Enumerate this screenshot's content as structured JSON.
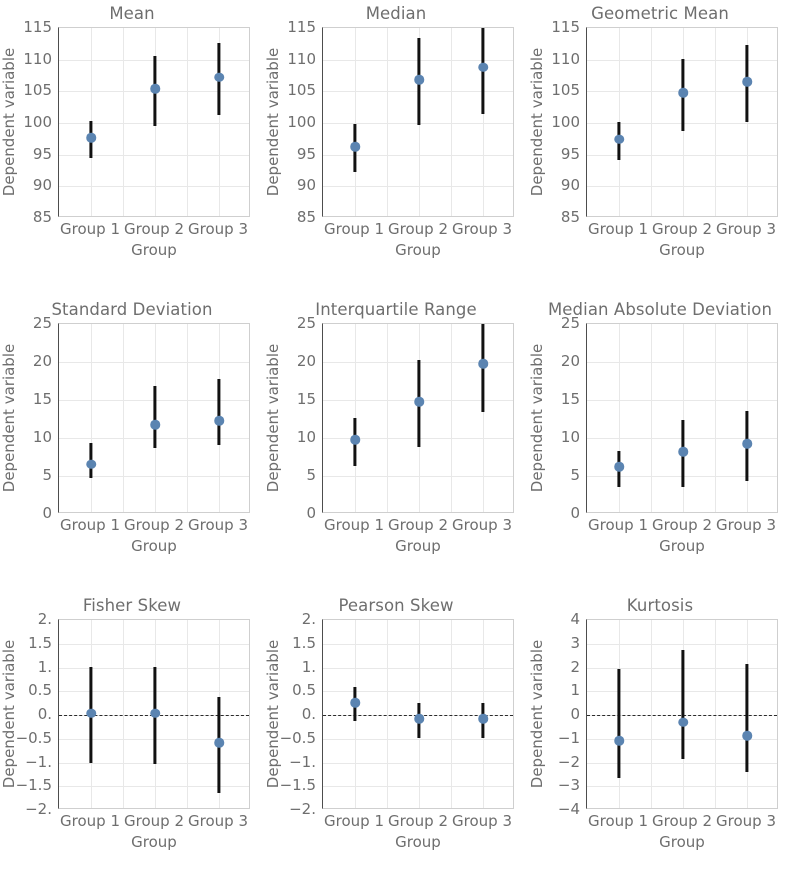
{
  "figure": {
    "rows": 3,
    "cols": 3,
    "background": "#ffffff",
    "marker_color": "#5b84b1",
    "errorbar_color": "#111111",
    "grid_color": "#e8e8e8",
    "text_color": "#6e6e6e",
    "zero_line_color": "#2b2b2b"
  },
  "chart_data": [
    {
      "type": "scatter",
      "title": "Mean",
      "xlabel": "Group",
      "ylabel": "Dependent variable",
      "categories": [
        "Group 1",
        "Group 2",
        "Group 3"
      ],
      "yticks": [
        "85",
        "90",
        "95",
        "100",
        "105",
        "110",
        "115"
      ],
      "ytick_values": [
        85,
        90,
        95,
        100,
        105,
        110,
        115
      ],
      "ylim": [
        85,
        115
      ],
      "grid": true,
      "zero_line": false,
      "values": [
        97.35,
        105.1,
        106.9
      ],
      "err_low": [
        94.4,
        99.6,
        101.2
      ],
      "err_high": [
        100.3,
        110.6,
        112.7
      ]
    },
    {
      "type": "scatter",
      "title": "Median",
      "xlabel": "Group",
      "ylabel": "Dependent variable",
      "categories": [
        "Group 1",
        "Group 2",
        "Group 3"
      ],
      "yticks": [
        "85",
        "90",
        "95",
        "100",
        "105",
        "110",
        "115"
      ],
      "ytick_values": [
        85,
        90,
        95,
        100,
        105,
        110,
        115
      ],
      "ylim": [
        85,
        115
      ],
      "grid": true,
      "zero_line": false,
      "values": [
        95.95,
        106.5,
        108.5
      ],
      "err_low": [
        92.3,
        99.7,
        101.4
      ],
      "err_high": [
        99.8,
        113.4,
        115.0
      ]
    },
    {
      "type": "scatter",
      "title": "Geometric Mean",
      "xlabel": "Group",
      "ylabel": "Dependent variable",
      "categories": [
        "Group 1",
        "Group 2",
        "Group 3"
      ],
      "yticks": [
        "85",
        "90",
        "95",
        "100",
        "105",
        "110",
        "115"
      ],
      "ytick_values": [
        85,
        90,
        95,
        100,
        105,
        110,
        115
      ],
      "ylim": [
        85,
        115
      ],
      "grid": true,
      "zero_line": false,
      "values": [
        97.15,
        104.45,
        106.2
      ],
      "err_low": [
        94.1,
        98.7,
        100.1
      ],
      "err_high": [
        100.1,
        110.1,
        112.3
      ]
    },
    {
      "type": "scatter",
      "title": "Standard Deviation",
      "xlabel": "Group",
      "ylabel": "Dependent variable",
      "categories": [
        "Group 1",
        "Group 2",
        "Group 3"
      ],
      "yticks": [
        "0",
        "5",
        "10",
        "15",
        "20",
        "25"
      ],
      "ytick_values": [
        0,
        5,
        10,
        15,
        20,
        25
      ],
      "ylim": [
        0,
        25
      ],
      "grid": true,
      "zero_line": false,
      "values": [
        6.3,
        11.5,
        12.0
      ],
      "err_low": [
        4.8,
        8.7,
        9.1
      ],
      "err_high": [
        9.3,
        16.9,
        17.7
      ]
    },
    {
      "type": "scatter",
      "title": "Interquartile Range",
      "xlabel": "Group",
      "ylabel": "Dependent variable",
      "categories": [
        "Group 1",
        "Group 2",
        "Group 3"
      ],
      "yticks": [
        "0",
        "5",
        "10",
        "15",
        "20",
        "25"
      ],
      "ytick_values": [
        0,
        5,
        10,
        15,
        20,
        25
      ],
      "ylim": [
        0,
        25
      ],
      "grid": true,
      "zero_line": false,
      "values": [
        9.5,
        14.5,
        19.5
      ],
      "err_low": [
        6.3,
        8.8,
        13.4
      ],
      "err_high": [
        12.6,
        20.2,
        25.0
      ]
    },
    {
      "type": "scatter",
      "title": "Median Absolute Deviation",
      "xlabel": "Group",
      "ylabel": "Dependent variable",
      "categories": [
        "Group 1",
        "Group 2",
        "Group 3"
      ],
      "yticks": [
        "0",
        "5",
        "10",
        "15",
        "20",
        "25"
      ],
      "ytick_values": [
        0,
        5,
        10,
        15,
        20,
        25
      ],
      "ylim": [
        0,
        25
      ],
      "grid": true,
      "zero_line": false,
      "values": [
        5.95,
        7.9,
        8.95
      ],
      "err_low": [
        3.6,
        3.6,
        4.4
      ],
      "err_high": [
        8.3,
        12.4,
        13.6
      ]
    },
    {
      "type": "scatter",
      "title": "Fisher Skew",
      "xlabel": "Group",
      "ylabel": "Dependent variable",
      "categories": [
        "Group 1",
        "Group 2",
        "Group 3"
      ],
      "yticks": [
        "2.",
        "1.5",
        "1.",
        "0.5",
        "0.",
        "-0.5",
        "-1.",
        "-1.5",
        "-2."
      ],
      "ytick_values": [
        2,
        1.5,
        1,
        0.5,
        0,
        -0.5,
        -1,
        -1.5,
        -2
      ],
      "ylim": [
        -2,
        2
      ],
      "grid": true,
      "zero_line": true,
      "values": [
        0.0,
        -0.01,
        -0.63
      ],
      "err_low": [
        -1.02,
        -1.03,
        -1.65
      ],
      "err_high": [
        1.02,
        1.02,
        0.38
      ]
    },
    {
      "type": "scatter",
      "title": "Pearson Skew",
      "xlabel": "Group",
      "ylabel": "Dependent variable",
      "categories": [
        "Group 1",
        "Group 2",
        "Group 3"
      ],
      "yticks": [
        "2.",
        "1.5",
        "1.",
        "0.5",
        "0.",
        "-0.5",
        "-1.",
        "-1.5",
        "-2."
      ],
      "ytick_values": [
        2,
        1.5,
        1,
        0.5,
        0,
        -0.5,
        -1,
        -1.5,
        -2
      ],
      "ylim": [
        -2,
        2
      ],
      "grid": true,
      "zero_line": true,
      "values": [
        0.22,
        -0.12,
        -0.12
      ],
      "err_low": [
        -0.13,
        -0.48,
        -0.48
      ],
      "err_high": [
        0.6,
        0.25,
        0.25
      ]
    },
    {
      "type": "scatter",
      "title": "Kurtosis",
      "xlabel": "Group",
      "ylabel": "Dependent variable",
      "categories": [
        "Group 1",
        "Group 2",
        "Group 3"
      ],
      "yticks": [
        "4",
        "3",
        "2",
        "1",
        "0",
        "-1",
        "-2",
        "-3",
        "-4"
      ],
      "ytick_values": [
        4,
        3,
        2,
        1,
        0,
        -1,
        -2,
        -3,
        -4
      ],
      "ylim": [
        -4,
        4
      ],
      "grid": true,
      "zero_line": true,
      "values": [
        -1.17,
        -0.38,
        -0.95
      ],
      "err_low": [
        -2.65,
        -1.87,
        -2.42
      ],
      "err_high": [
        1.93,
        2.72,
        2.13
      ]
    }
  ]
}
